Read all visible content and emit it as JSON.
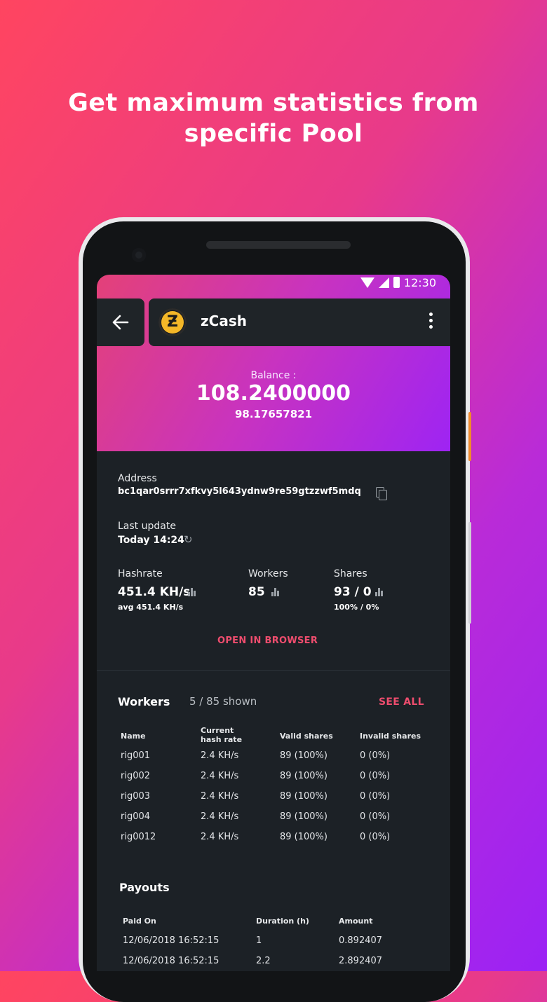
{
  "headline": {
    "line1": "Get maximum statistics from",
    "line2": "specific Pool"
  },
  "status_bar": {
    "time": "12:30"
  },
  "app_bar": {
    "title": "zCash",
    "coin_symbol": "Ƶ"
  },
  "balance": {
    "label": "Balance :",
    "value": "108.2400000",
    "secondary": "98.17657821"
  },
  "address": {
    "label": "Address",
    "value": "bc1qar0srrr7xfkvy5l643ydnw9re59gtzzwf5mdq"
  },
  "last_update": {
    "label": "Last update",
    "value": "Today 14:24"
  },
  "stats": {
    "hashrate": {
      "label": "Hashrate",
      "value": "451.4 KH/s",
      "sub": "avg 451.4 KH/s"
    },
    "workers": {
      "label": "Workers",
      "value": "85"
    },
    "shares": {
      "label": "Shares",
      "value": "93 / 0",
      "sub": "100% / 0%"
    }
  },
  "open_browser_label": "OPEN IN BROWSER",
  "workers_section": {
    "title": "Workers",
    "shown": "5 / 85 shown",
    "see_all": "SEE ALL",
    "headers": {
      "name": "Name",
      "current_line1": "Current",
      "current_line2": "hash rate",
      "valid": "Valid shares",
      "invalid": "Invalid shares"
    },
    "rows": [
      {
        "name": "rig001",
        "rate": "2.4 KH/s",
        "valid": "89 (100%)",
        "invalid": "0 (0%)"
      },
      {
        "name": "rig002",
        "rate": "2.4 KH/s",
        "valid": "89 (100%)",
        "invalid": "0 (0%)"
      },
      {
        "name": "rig003",
        "rate": "2.4 KH/s",
        "valid": "89 (100%)",
        "invalid": "0 (0%)"
      },
      {
        "name": "rig004",
        "rate": "2.4 KH/s",
        "valid": "89 (100%)",
        "invalid": "0 (0%)"
      },
      {
        "name": "rig0012",
        "rate": "2.4 KH/s",
        "valid": "89 (100%)",
        "invalid": "0 (0%)"
      }
    ]
  },
  "payouts_section": {
    "title": "Payouts",
    "headers": {
      "paid_on": "Paid On",
      "duration": "Duration (h)",
      "amount": "Amount"
    },
    "rows": [
      {
        "paid_on": "12/06/2018 16:52:15",
        "duration": "1",
        "amount": "0.892407"
      },
      {
        "paid_on": "12/06/2018 16:52:15",
        "duration": "2.2",
        "amount": "2.892407"
      }
    ]
  },
  "colors": {
    "accent": "#ef4d6e",
    "card_bg": "#1c2126",
    "appbar_bg": "#1f2428",
    "coin": "#f4b728"
  }
}
